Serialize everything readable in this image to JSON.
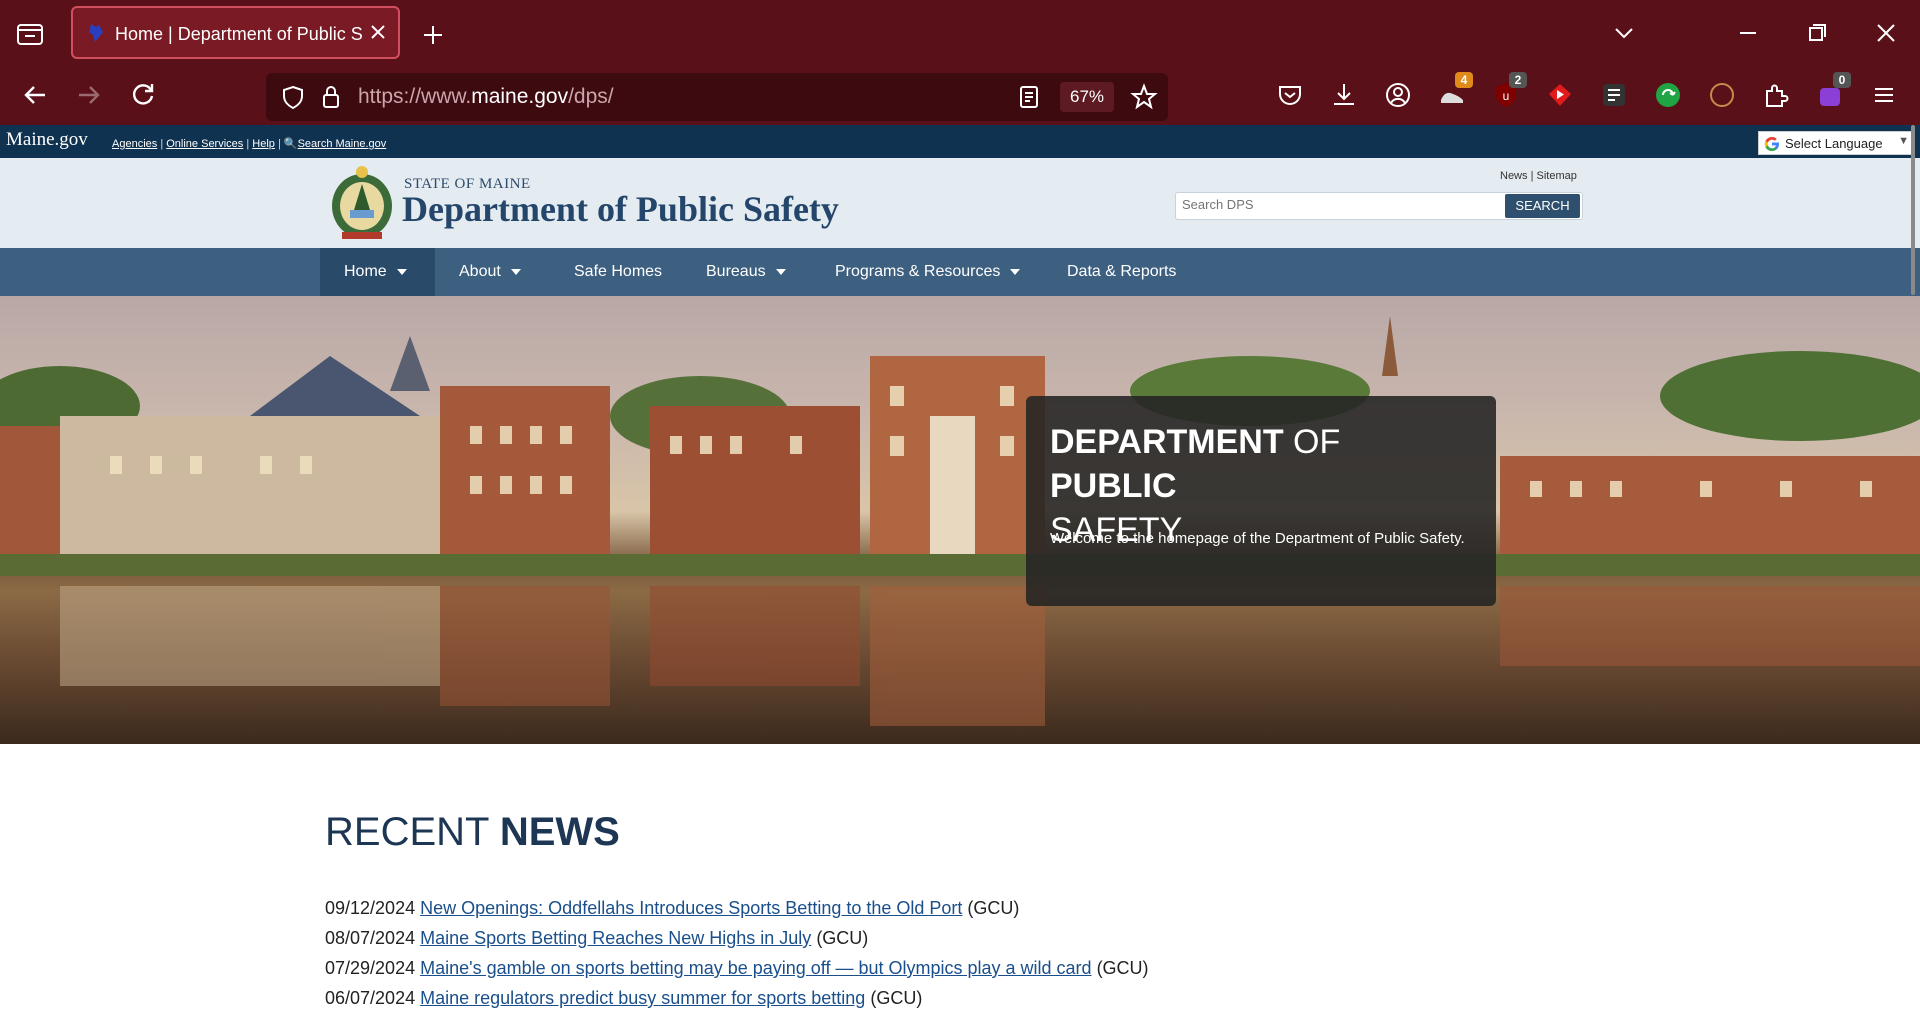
{
  "browser": {
    "tab_title": "Home | Department of Public Sa",
    "url_prefix": "https://www.",
    "url_host": "maine.gov",
    "url_path": "/dps/",
    "zoom": "67%",
    "badges": {
      "ext1": "4",
      "ublock": "2",
      "ext_last": "0"
    }
  },
  "gov_bar": {
    "logo": "Maine.gov",
    "links": [
      "Agencies",
      "Online Services",
      "Help",
      "Search Maine.gov"
    ],
    "language": "Select Language"
  },
  "header": {
    "state": "STATE OF MAINE",
    "department": "Department of Public Safety",
    "top_links": [
      "News",
      "Sitemap"
    ],
    "search_placeholder": "Search DPS",
    "search_button": "SEARCH"
  },
  "nav": {
    "items": [
      {
        "label": "Home",
        "dropdown": true
      },
      {
        "label": "About",
        "dropdown": true
      },
      {
        "label": "Safe Homes",
        "dropdown": false
      },
      {
        "label": "Bureaus",
        "dropdown": true
      },
      {
        "label": "Programs & Resources",
        "dropdown": true
      },
      {
        "label": "Data & Reports",
        "dropdown": false
      }
    ]
  },
  "hero": {
    "title_bold_1": "DEPARTMENT",
    "title_mid": " OF ",
    "title_bold_2": "PUBLIC",
    "title_end": "SAFETY",
    "description": "Welcome to the homepage of the Department of Public Safety."
  },
  "news": {
    "heading_light": "RECENT ",
    "heading_bold": "NEWS",
    "items": [
      {
        "date": "09/12/2024",
        "title": "New Openings: Oddfellahs Introduces Sports Betting to the Old Port",
        "source": "(GCU)"
      },
      {
        "date": "08/07/2024",
        "title": "Maine Sports Betting Reaches New Highs in July",
        "source": "(GCU)"
      },
      {
        "date": "07/29/2024",
        "title": "Maine's gamble on sports betting may be paying off — but Olympics play a wild card",
        "source": "(GCU)"
      },
      {
        "date": "06/07/2024",
        "title": "Maine regulators predict busy summer for sports betting",
        "source": "(GCU)"
      }
    ]
  }
}
